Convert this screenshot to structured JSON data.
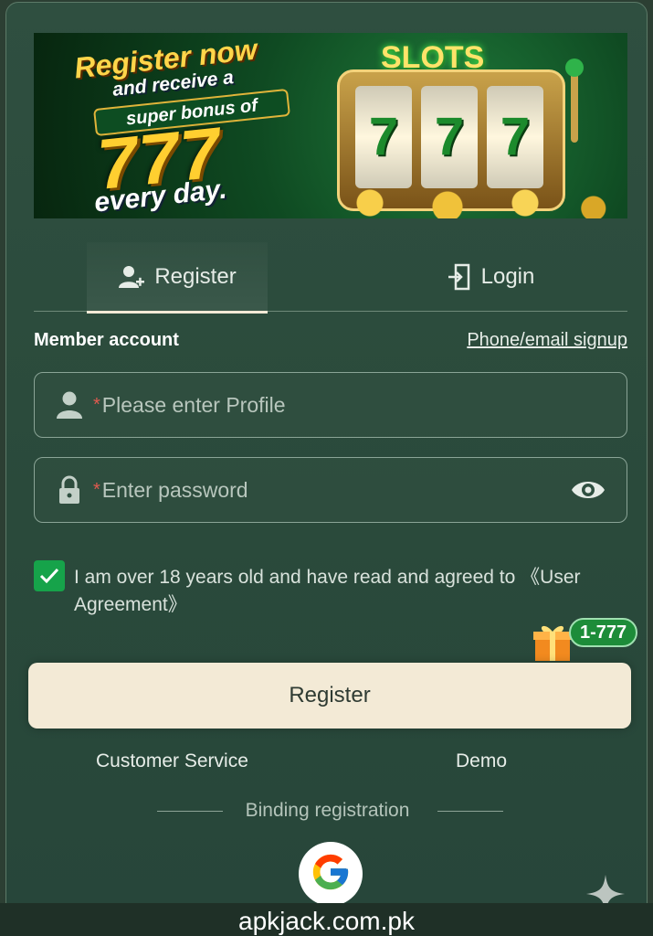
{
  "banner": {
    "line1": "Register now",
    "line2": "and receive a",
    "line3": "super bonus of",
    "big_number": "777",
    "line4": "every day.",
    "slot_title": "SLOTS",
    "reels": [
      "7",
      "7",
      "7"
    ]
  },
  "tabs": [
    {
      "label": "Register",
      "icon": "add-user-icon",
      "active": true
    },
    {
      "label": "Login",
      "icon": "login-door-icon",
      "active": false
    }
  ],
  "form": {
    "section_title": "Member account",
    "alt_signup_link": "Phone/email signup",
    "required_mark": "*",
    "username_placeholder": "Please enter Profile",
    "password_placeholder": "Enter password",
    "agreement_text": "I am over 18 years old and have read and agreed to 《User Agreement》",
    "agreement_checked": true,
    "bonus_badge": "1-777",
    "submit_label": "Register"
  },
  "links": {
    "customer_service": "Customer Service",
    "demo": "Demo"
  },
  "binding": {
    "label": "Binding registration",
    "providers": [
      "google-icon"
    ]
  },
  "footer": {
    "watermark": "apkjack.com.pk"
  },
  "colors": {
    "modal_bg": "#2f4f40",
    "button_bg": "#f3ead6",
    "checkbox": "#16a34a",
    "required": "#e05a4f"
  }
}
